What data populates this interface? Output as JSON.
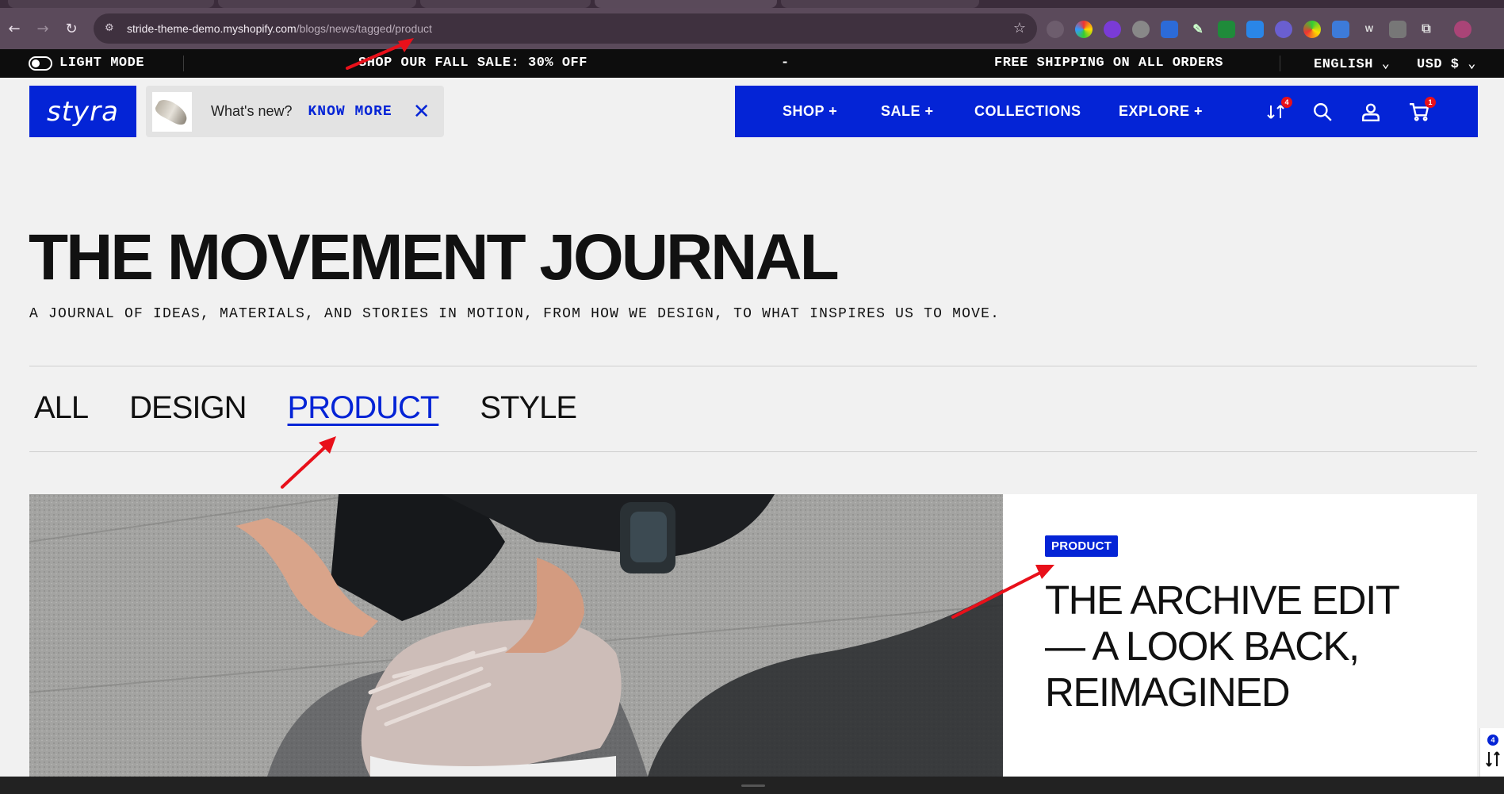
{
  "browser": {
    "url_host": "stride-theme-demo.myshopify.com",
    "url_path": "/blogs/news/tagged/product"
  },
  "announcement": {
    "mode_label": "LIGHT MODE",
    "sale_text": "SHOP OUR FALL SALE: 30% OFF",
    "divider_text": "-",
    "shipping_text": "FREE SHIPPING ON ALL ORDERS",
    "language": "ENGLISH",
    "currency": "USD $"
  },
  "header": {
    "logo_text": "styra",
    "whats_new_label": "What's new?",
    "know_more_label": "KNOW MORE",
    "nav": [
      {
        "label": "SHOP +"
      },
      {
        "label": "SALE +"
      },
      {
        "label": "COLLECTIONS"
      },
      {
        "label": "EXPLORE +"
      }
    ],
    "compare_count": "4",
    "cart_count": "1"
  },
  "journal": {
    "title": "THE MOVEMENT JOURNAL",
    "description": "A JOURNAL OF IDEAS, MATERIALS, AND STORIES IN MOTION, FROM HOW WE DESIGN, TO WHAT INSPIRES US TO MOVE.",
    "filters": [
      {
        "label": "ALL",
        "active": false
      },
      {
        "label": "DESIGN",
        "active": false
      },
      {
        "label": "PRODUCT",
        "active": true
      },
      {
        "label": "STYLE",
        "active": false
      }
    ]
  },
  "featured_post": {
    "tag": "PRODUCT",
    "title": "THE ARCHIVE EDIT — A LOOK BACK, REIMAGINED"
  },
  "side_widget": {
    "count": "4"
  },
  "colors": {
    "brand_blue": "#0424d6",
    "annotation_red": "#e8101a",
    "announcement_bg": "#0d0d0d",
    "page_bg": "#f1f1f1"
  }
}
